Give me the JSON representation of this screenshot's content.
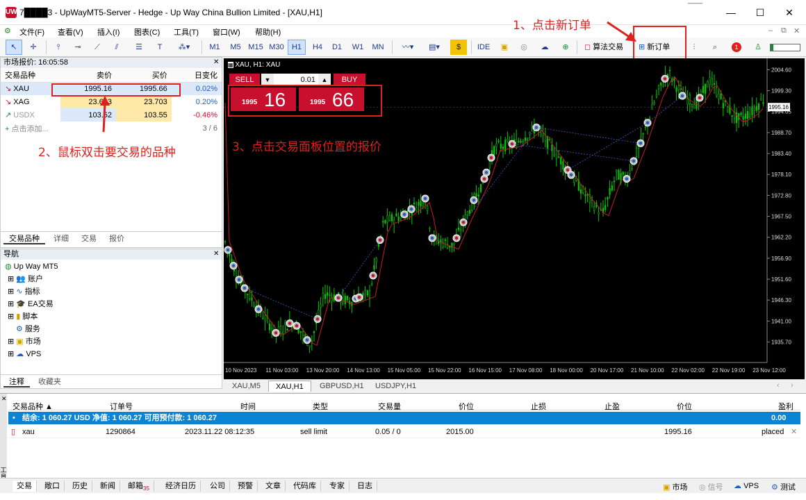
{
  "window": {
    "app_icon": "UW",
    "title": "7████3 - UpWayMT5-Server - Hedge - Up Way China Bullion Limited - [XAU,H1]",
    "min": "—",
    "max": "☐",
    "close": "✕",
    "right_clip": "───"
  },
  "menu": [
    "文件(F)",
    "查看(V)",
    "插入(I)",
    "图表(C)",
    "工具(T)",
    "窗口(W)",
    "帮助(H)"
  ],
  "menu_right": [
    "–",
    "⧉",
    "✕"
  ],
  "toolbar": {
    "timeframes": [
      "M1",
      "M5",
      "M15",
      "M30",
      "H1",
      "H4",
      "D1",
      "W1",
      "MN"
    ],
    "active_tf": "H1",
    "ide": "IDE",
    "algo_trading": "算法交易",
    "new_order": "新订单",
    "badge": "1"
  },
  "annotations": {
    "a1": "1、点击新订单",
    "a2": "2、鼠标双击要交易的品种",
    "a3": "3、点击交易面板位置的报价"
  },
  "market_watch": {
    "header": "市场报价: 16:05:58",
    "columns": [
      "交易品种",
      "卖价",
      "买价",
      "日变化"
    ],
    "rows": [
      {
        "dir": "↘",
        "symbol": "XAU",
        "bid": "1995.16",
        "ask": "1995.66",
        "change": "0.02%"
      },
      {
        "dir": "↘",
        "symbol": "XAG",
        "bid": "23.663",
        "ask": "23.703",
        "change": "0.20%"
      },
      {
        "dir": "↗",
        "symbol": "USDX",
        "bid": "103.52",
        "ask": "103.55",
        "change": "-0.46%"
      }
    ],
    "add": "点击添加...",
    "count": "3 / 6",
    "tabs": [
      "交易品种",
      "详细",
      "交易",
      "报价"
    ]
  },
  "navigator": {
    "header": "导航",
    "root": "Up Way MT5",
    "items": [
      "账户",
      "指标",
      "EA交易",
      "脚本",
      "服务",
      "市场",
      "VPS"
    ],
    "tabs": [
      "注释",
      "收藏夹"
    ]
  },
  "chart": {
    "symbol_label": "XAU, H1:  XAU",
    "one_click": {
      "sell": "SELL",
      "buy": "BUY",
      "lot": "0.01",
      "sell_big": "16",
      "sell_small": "1995",
      "buy_big": "66",
      "buy_small": "1995"
    },
    "price_ticks": [
      "2004.60",
      "1999.30",
      "1994.05",
      "1988.70",
      "1983.40",
      "1978.10",
      "1972.80",
      "1967.50",
      "1962.20",
      "1956.90",
      "1951.60",
      "1946.30",
      "1941.00",
      "1935.70"
    ],
    "current_price": "1995.16",
    "time_ticks": [
      "10 Nov 2023",
      "11 Nov 03:00",
      "13 Nov 20:00",
      "14 Nov 13:00",
      "15 Nov 05:00",
      "15 Nov 22:00",
      "16 Nov 15:00",
      "17 Nov 08:00",
      "18 Nov 00:00",
      "20 Nov 17:00",
      "21 Nov 10:00",
      "22 Nov 02:00",
      "22 Nov 19:00",
      "23 Nov 12:00"
    ],
    "tabs": [
      "XAU,M5",
      "XAU,H1",
      "GBPUSD,H1",
      "USDJPY,H1"
    ],
    "active_tab": "XAU,H1",
    "colors": {
      "up": "#00c800",
      "down": "#00c800",
      "ma_red": "#c81e1e"
    }
  },
  "toolbox": {
    "columns": [
      "交易品种",
      "订单号",
      "时间",
      "类型",
      "交易量",
      "价位",
      "止损",
      "止盈",
      "价位",
      "盈利"
    ],
    "balance": "结余: 1 060.27 USD  净值: 1 060.27  可用预付款: 1 060.27",
    "balance_value": "0.00",
    "order": {
      "symbol": "xau",
      "ticket": "1290864",
      "time": "2023.11.22 08:12:35",
      "type": "sell limit",
      "volume": "0.05 / 0",
      "price": "2015.00",
      "sl": "",
      "tp": "",
      "cur_price": "1995.16",
      "status": "placed"
    }
  },
  "bottom_tabs": [
    "交易",
    "敞口",
    "历史",
    "新闻",
    "邮箱",
    "经济日历",
    "公司",
    "预警",
    "文章",
    "代码库",
    "专家",
    "日志"
  ],
  "mail_count": "35",
  "status_right": [
    "市场",
    "信号",
    "VPS",
    "测试"
  ],
  "side_label": "工具箱"
}
